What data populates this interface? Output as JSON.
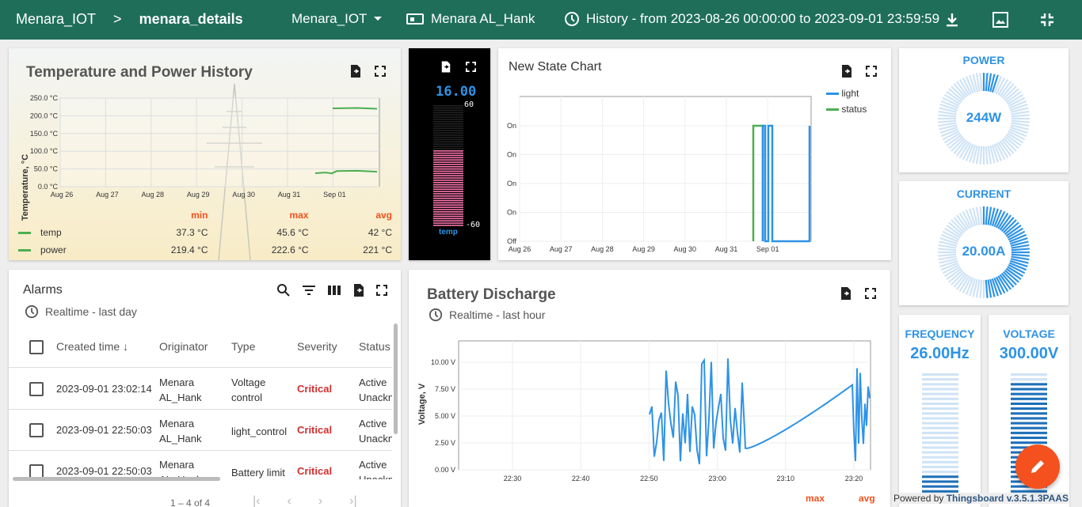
{
  "header": {
    "crumb_root": "Menara_IOT",
    "crumb_sep": ">",
    "crumb_current": "menara_details",
    "entity_select": "Menara_IOT",
    "device_label": "Menara AL_Hank",
    "history_label": "History - from 2023-08-26 00:00:00 to 2023-09-01 23:59:59"
  },
  "temp_power": {
    "title": "Temperature and Power History",
    "ylabel": "Temperature, °C",
    "yticks": [
      "250.0 °C",
      "200.0 °C",
      "150.0 °C",
      "100.0 °C",
      "50.0 °C",
      "0.0 °C"
    ],
    "xticks": [
      "Aug 26",
      "Aug 27",
      "Aug 28",
      "Aug 29",
      "Aug 30",
      "Aug 31",
      "Sep 01"
    ],
    "col_min": "min",
    "col_max": "max",
    "col_avg": "avg",
    "rows": [
      {
        "name": "temp",
        "min": "37.3 °C",
        "max": "45.6 °C",
        "avg": "42 °C"
      },
      {
        "name": "power",
        "min": "219.4 °C",
        "max": "222.6 °C",
        "avg": "221 °C"
      }
    ],
    "color": "#4caf50"
  },
  "thermo": {
    "value": "16.00",
    "max": "60",
    "min": "-60",
    "label": "temp",
    "level": 0.63
  },
  "state_chart": {
    "title": "New State Chart",
    "yticks": [
      "On",
      "On",
      "On",
      "On",
      "Off"
    ],
    "xticks": [
      "Aug 26",
      "Aug 27",
      "Aug 28",
      "Aug 29",
      "Aug 30",
      "Aug 31",
      "Sep 01"
    ],
    "legend": [
      {
        "name": "light",
        "color": "#2e93e6"
      },
      {
        "name": "status",
        "color": "#4caf50"
      }
    ]
  },
  "power": {
    "label": "POWER",
    "value": "244W",
    "level": 0.06
  },
  "current": {
    "label": "CURRENT",
    "value": "20.00A",
    "level": 0.5
  },
  "frequency": {
    "label": "FREQUENCY",
    "value": "26.00Hz",
    "level": 0.2
  },
  "voltage": {
    "label": "VOLTAGE",
    "value": "300.00V",
    "level": 0.95
  },
  "alarms": {
    "title": "Alarms",
    "timewindow": "Realtime - last day",
    "columns": [
      "Created time",
      "Originator",
      "Type",
      "Severity",
      "Status"
    ],
    "rows": [
      {
        "time": "2023-09-01 23:02:14",
        "orig1": "Menara",
        "orig2": "AL_Hank",
        "type1": "Voltage",
        "type2": "control",
        "severity": "Critical",
        "status1": "Active",
        "status2": "Unackn"
      },
      {
        "time": "2023-09-01 22:50:03",
        "orig1": "Menara",
        "orig2": "AL_Hank",
        "type1": "light_control",
        "type2": "",
        "severity": "Critical",
        "status1": "Active",
        "status2": "Unackn"
      },
      {
        "time": "2023-09-01 22:50:03",
        "orig1": "Menara",
        "orig2": "AL_Hank",
        "type1": "Battery limit",
        "type2": "",
        "severity": "Critical",
        "status1": "Active",
        "status2": "Unackn"
      }
    ],
    "pagination": "1 – 4 of 4"
  },
  "battery": {
    "title": "Battery Discharge",
    "timewindow": "Realtime - last hour",
    "ylabel": "Voltage, V",
    "yticks": [
      "10.00 V",
      "7.50 V",
      "5.00 V",
      "2.50 V",
      "0.00 V"
    ],
    "xticks": [
      "22:30",
      "22:40",
      "22:50",
      "23:00",
      "23:10",
      "23:20"
    ],
    "col_max": "max",
    "col_avg": "avg",
    "color": "#2e93e6"
  },
  "footer": {
    "powered": "Powered by",
    "brand": "Thingsboard v.3.5.1.3PAAS"
  }
}
